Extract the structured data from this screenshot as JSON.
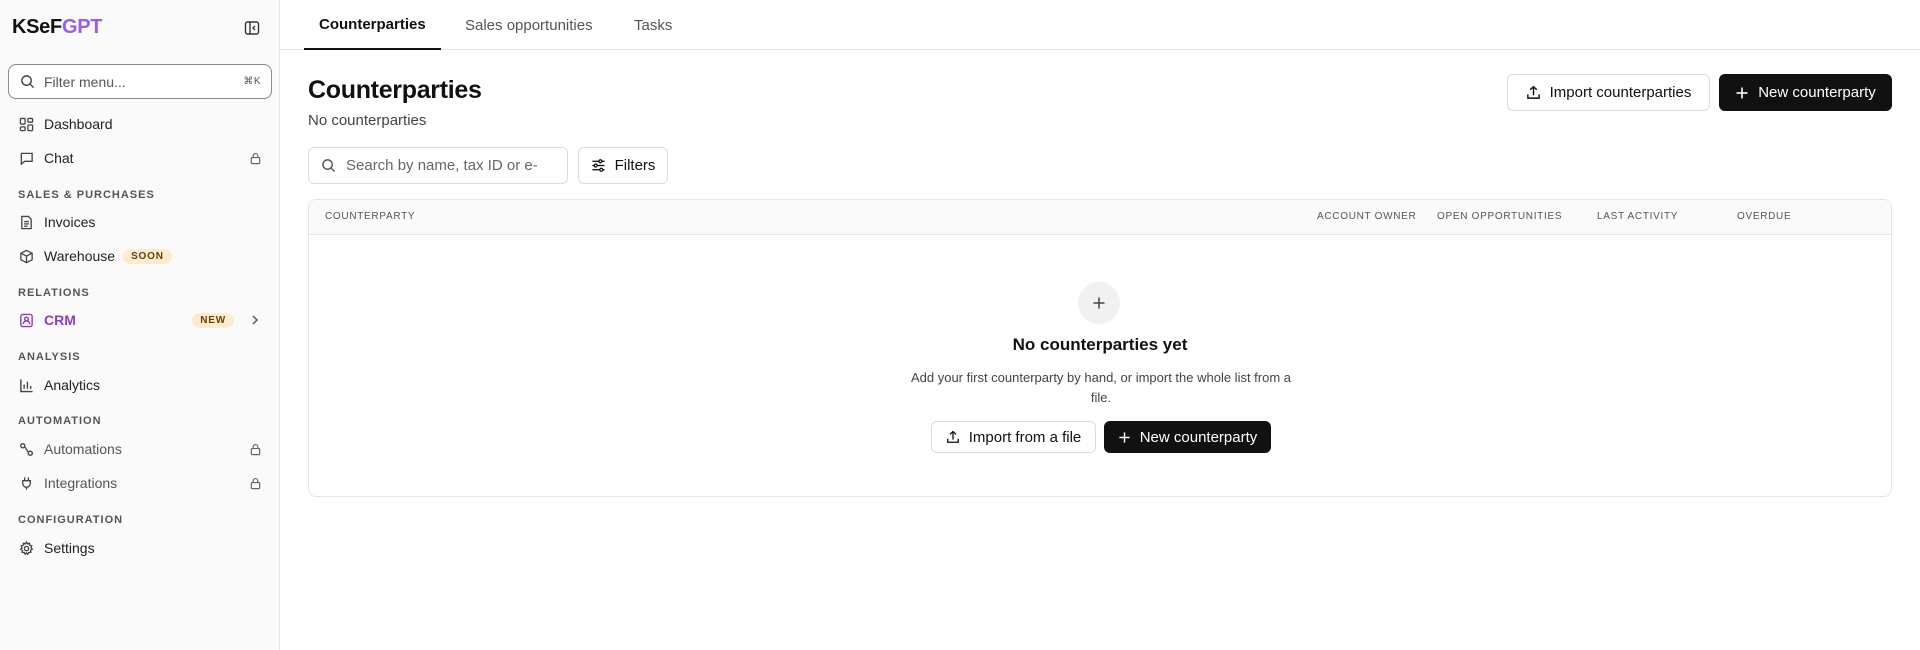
{
  "app": {
    "logo_main": "KSeF",
    "logo_accent": "GPT"
  },
  "sidebar": {
    "filter_placeholder": "Filter menu...",
    "filter_shortcut": "⌘K",
    "items": {
      "dashboard": {
        "label": "Dashboard",
        "icon": "grid-icon"
      },
      "chat": {
        "label": "Chat",
        "icon": "chat-icon",
        "locked": true
      },
      "invoices": {
        "label": "Invoices",
        "icon": "document-icon"
      },
      "warehouse": {
        "label": "Warehouse",
        "icon": "box-icon",
        "badge": "SOON"
      },
      "crm": {
        "label": "CRM",
        "icon": "contact-icon",
        "badge": "NEW",
        "active": true
      },
      "analytics": {
        "label": "Analytics",
        "icon": "bar-chart-icon"
      },
      "automations": {
        "label": "Automations",
        "icon": "workflow-icon",
        "locked": true
      },
      "integrations": {
        "label": "Integrations",
        "icon": "plug-icon",
        "locked": true
      },
      "settings": {
        "label": "Settings",
        "icon": "gear-icon"
      }
    },
    "sections": {
      "sales": "SALES & PURCHASES",
      "relations": "RELATIONS",
      "analysis": "ANALYSIS",
      "automation": "AUTOMATION",
      "configuration": "CONFIGURATION"
    }
  },
  "tabs": [
    {
      "label": "Counterparties",
      "active": true
    },
    {
      "label": "Sales opportunities",
      "active": false
    },
    {
      "label": "Tasks",
      "active": false
    }
  ],
  "page": {
    "title": "Counterparties",
    "subtitle": "No counterparties",
    "import_button": "Import counterparties",
    "new_button": "New counterparty",
    "search_placeholder": "Search by name, tax ID or e-",
    "filters_button": "Filters"
  },
  "table": {
    "columns": [
      "COUNTERPARTY",
      "ACCOUNT OWNER",
      "OPEN OPPORTUNITIES",
      "LAST ACTIVITY",
      "OVERDUE"
    ],
    "empty": {
      "title": "No counterparties yet",
      "description": "Add your first counterparty by hand, or import the whole list from a file.",
      "import_button": "Import from a file",
      "new_button": "New counterparty"
    }
  },
  "colors": {
    "accent": "#9b5de5",
    "dark_button": "#111111",
    "badge_bg": "#fdebd0"
  }
}
